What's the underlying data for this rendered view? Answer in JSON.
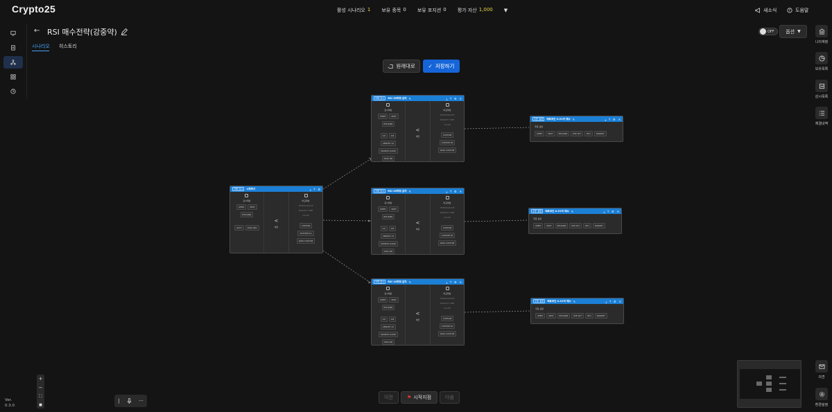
{
  "app": {
    "title": "Crypto25",
    "version_label": "Ver.",
    "version": "0.3.0"
  },
  "stats": [
    {
      "label": "활성 시나리오",
      "value": "1",
      "highlight": true
    },
    {
      "label": "보유 종목",
      "value": "0",
      "highlight": false
    },
    {
      "label": "보유 포지션",
      "value": "0",
      "highlight": false
    },
    {
      "label": "평가 자산",
      "value": "1,000",
      "highlight": true
    }
  ],
  "topright": {
    "news": "새소식",
    "help": "도움말"
  },
  "leftnav": [
    {
      "icon": "monitor-icon"
    },
    {
      "icon": "document-icon"
    },
    {
      "icon": "network-icon",
      "active": true
    },
    {
      "icon": "grid-icon"
    },
    {
      "icon": "history-icon"
    }
  ],
  "page": {
    "title": "RSI 매수전략(강중약)"
  },
  "tabs": {
    "scenario": "시나리오",
    "history": "히스토리"
  },
  "toggle": {
    "label": "OFF"
  },
  "options": {
    "label": "옵션"
  },
  "actions": {
    "revert": "원래대로",
    "save": "저장하기"
  },
  "rightbar": [
    {
      "label": "나의계정",
      "icon": "bank-icon"
    },
    {
      "label": "보유목록",
      "icon": "pie-chart-icon"
    },
    {
      "label": "감시목록",
      "icon": "watch-list-icon"
    },
    {
      "label": "체결내역",
      "icon": "list-icon"
    },
    {
      "label": "의견",
      "icon": "mail-icon"
    },
    {
      "label": "환경설정",
      "icon": "gear-icon"
    }
  ],
  "nodes": {
    "start": {
      "tag": "아래 감시",
      "title": "시작하기",
      "left": {
        "label": "감시대상",
        "chips1": [
          "UPBIT",
          "SPOT"
        ],
        "chips2": [
          "BTC/KRW"
        ],
        "chips3": [
          "ACCT",
          "DATA GET"
        ]
      },
      "op": "<",
      "thr": "예전",
      "right": {
        "label": "비교대상",
        "grays": [
          "TRENDGRADE",
          "MARKET TIME",
          "VALUE"
        ],
        "chips": [
          "CUSTOM",
          "CUSTOM 0.1",
          "DATA CUSTOM"
        ]
      }
    },
    "cond": [
      {
        "tag": "아래 감시",
        "title": "RSI 30하회 감지",
        "left": {
          "label": "감시대상",
          "chips1": [
            "UPBIT",
            "SPOT"
          ],
          "chips2": [
            "BTC/KRW"
          ],
          "chips3": [
            "1D",
            "1M"
          ],
          "chips4": [
            "LENGTH 14"
          ],
          "chips5": [
            "SOURCE CLOSE"
          ],
          "chips6": [
            "DATA RSI"
          ]
        },
        "op": "<",
        "thr": "예전",
        "right": {
          "label": "비교대상",
          "grays": [
            "TRENDGRADE",
            "MARKET TIME",
            "VALUE"
          ],
          "chips": [
            "CUSTOM",
            "CUSTOM 30",
            "DATA CUSTOM"
          ]
        }
      },
      {
        "tag": "아래 감시",
        "title": "RSI 20하회 감지",
        "left": {
          "label": "감시대상",
          "chips1": [
            "UPBIT",
            "SPOT"
          ],
          "chips2": [
            "BTC/KRW"
          ],
          "chips3": [
            "1D",
            "1M"
          ],
          "chips4": [
            "LENGTH 14"
          ],
          "chips5": [
            "SOURCE CLOSE"
          ],
          "chips6": [
            "DATA RSI"
          ]
        },
        "op": "<",
        "thr": "예전",
        "right": {
          "label": "비교대상",
          "grays": [
            "TRENDGRADE",
            "MARKET TIME",
            "VALUE"
          ],
          "chips": [
            "CUSTOM",
            "CUSTOM 20",
            "DATA CUSTOM"
          ]
        }
      },
      {
        "tag": "아래 감시",
        "title": "RSI 10하회 감지",
        "left": {
          "label": "감시대상",
          "chips1": [
            "UPBIT",
            "SPOT"
          ],
          "chips2": [
            "BTC/KRW"
          ],
          "chips3": [
            "1D",
            "1M"
          ],
          "chips4": [
            "LENGTH 14"
          ],
          "chips5": [
            "SOURCE CLOSE"
          ],
          "chips6": [
            "DATA RSI"
          ]
        },
        "op": "<",
        "thr": "예전",
        "right": {
          "label": "비교대상",
          "grays": [
            "TRENDGRADE",
            "MARKET TIME",
            "VALUE"
          ],
          "chips": [
            "CUSTOM",
            "CUSTOM 10",
            "DATA CUSTOM"
          ]
        }
      }
    ],
    "order": [
      {
        "tag": "주문 설정",
        "title": "매트코인 0.01씩 매수",
        "label": "주문 설정",
        "chips": [
          "UPBIT",
          "SPOT",
          "BTC/KRW",
          "EXE QTY",
          "BUY",
          "MARKET"
        ]
      },
      {
        "tag": "주문 설정",
        "title": "매트코인 0.01씩 매수",
        "label": "주문 설정",
        "chips": [
          "UPBIT",
          "SPOT",
          "BTC/KRW",
          "EXE QTY",
          "BUY",
          "MARKET"
        ]
      },
      {
        "tag": "주문 설정",
        "title": "매트코인 0.01씩 매수",
        "label": "주문 설정",
        "chips": [
          "UPBIT",
          "SPOT",
          "BTC/KRW",
          "EXE QTY",
          "BUY",
          "MARKET"
        ]
      }
    ]
  },
  "playback": {
    "prev": "이전",
    "start": "시작지점",
    "next": "다음"
  }
}
